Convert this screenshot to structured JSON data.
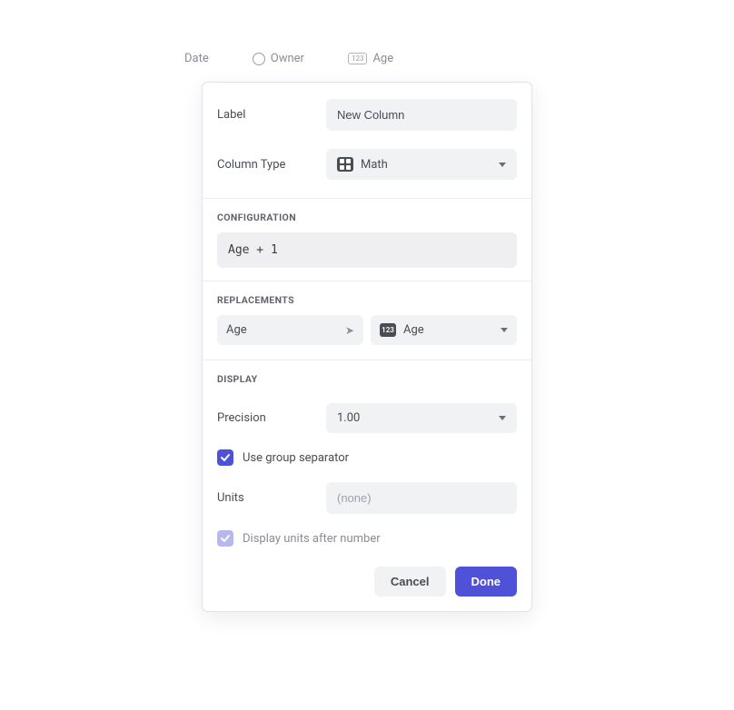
{
  "header_columns": {
    "date": "Date",
    "owner": "Owner",
    "age": "Age"
  },
  "form": {
    "label_label": "Label",
    "label_value": "New Column",
    "column_type_label": "Column Type",
    "column_type_value": "Math"
  },
  "configuration": {
    "header": "CONFIGURATION",
    "expression": "Age + 1"
  },
  "replacements": {
    "header": "REPLACEMENTS",
    "source": "Age",
    "target": "Age"
  },
  "display": {
    "header": "DISPLAY",
    "precision_label": "Precision",
    "precision_value": "1.00",
    "use_group_separator_label": "Use group separator",
    "units_label": "Units",
    "units_placeholder": "(none)",
    "display_units_after_label": "Display units after number"
  },
  "footer": {
    "cancel": "Cancel",
    "done": "Done"
  }
}
